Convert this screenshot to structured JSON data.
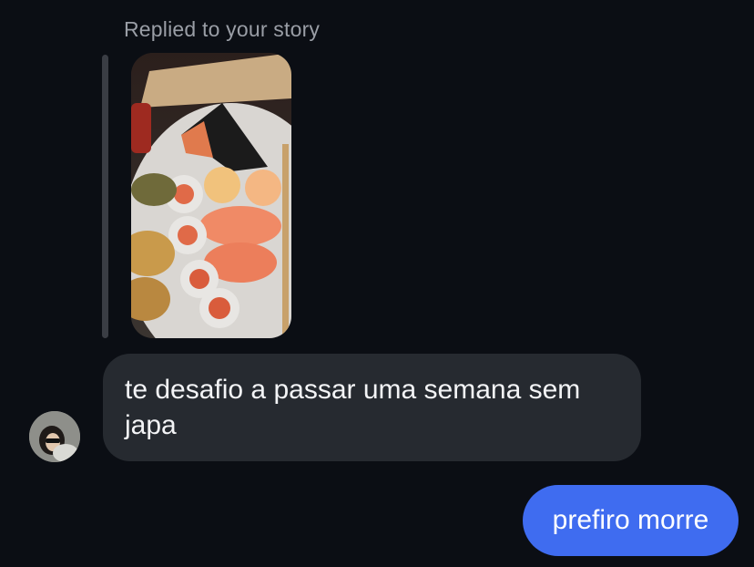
{
  "story_reply": {
    "label": "Replied to your story",
    "thumbnail_description": "story-photo"
  },
  "messages": [
    {
      "direction": "incoming",
      "text": "te desafio a passar uma semana sem japa"
    },
    {
      "direction": "outgoing",
      "text": "prefiro morre"
    }
  ],
  "colors": {
    "background": "#0b0e14",
    "incoming_bubble": "#262a30",
    "outgoing_bubble": "#3f6cf0",
    "label_text": "#9a9ea6"
  }
}
